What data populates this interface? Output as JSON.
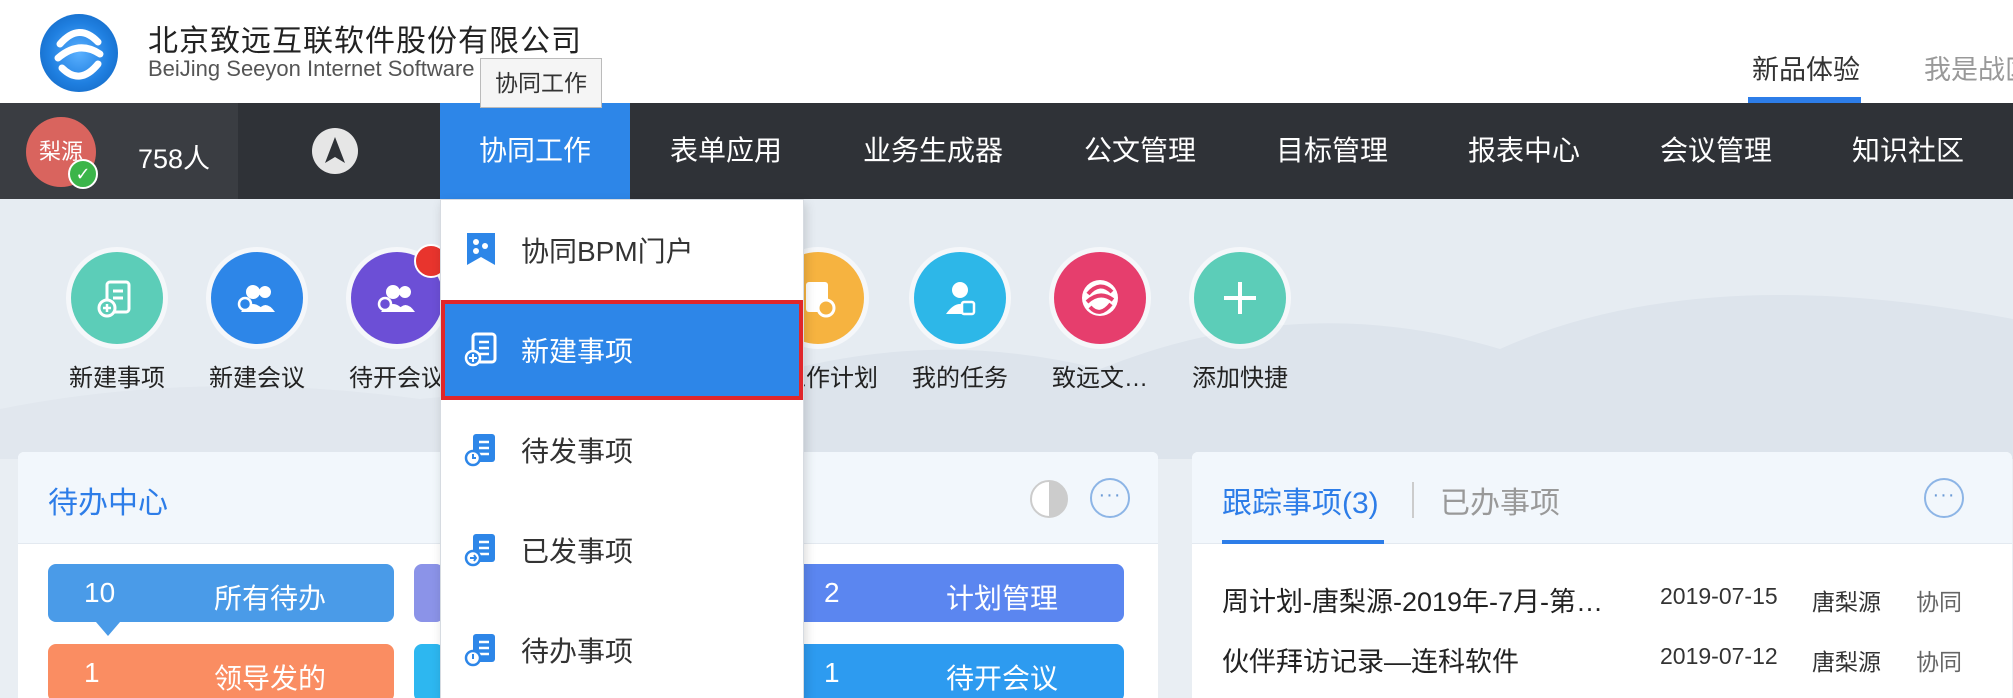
{
  "header": {
    "company_cn": "北京致远互联软件股份有限公司",
    "company_en": "BeiJing Seeyon Internet Software",
    "tabs": [
      {
        "label": "新品体验",
        "active": true
      },
      {
        "label": "我是战区",
        "active": false
      }
    ]
  },
  "user": {
    "avatar_text": "梨源",
    "people_count": "758人"
  },
  "nav": {
    "items": [
      {
        "label": "协同工作",
        "active": true
      },
      {
        "label": "表单应用"
      },
      {
        "label": "业务生成器"
      },
      {
        "label": "公文管理"
      },
      {
        "label": "目标管理"
      },
      {
        "label": "报表中心"
      },
      {
        "label": "会议管理"
      },
      {
        "label": "知识社区"
      }
    ],
    "tooltip": "协同工作"
  },
  "dropdown": {
    "items": [
      {
        "label": "协同BPM门户"
      },
      {
        "label": "新建事项",
        "selected": true
      },
      {
        "label": "待发事项"
      },
      {
        "label": "已发事项"
      },
      {
        "label": "待办事项"
      }
    ]
  },
  "shortcuts": [
    {
      "label": "新建事项",
      "color": "#5ccdb8",
      "icon": "new-item-icon"
    },
    {
      "label": "新建会议",
      "color": "#2d86e8",
      "icon": "new-meeting-icon"
    },
    {
      "label": "待开会议",
      "color": "#6c4fd6",
      "icon": "pending-meeting-icon"
    },
    {
      "label": "工作计划",
      "color": "#f6b340",
      "icon": "work-plan-icon"
    },
    {
      "label": "我的任务",
      "color": "#2db7e8",
      "icon": "my-task-icon"
    },
    {
      "label": "致远文…",
      "color": "#e63e6d",
      "icon": "seeyon-culture-icon"
    },
    {
      "label": "添加快捷",
      "color": "#5ccdb8",
      "icon": "add-shortcut-icon"
    }
  ],
  "todo_panel": {
    "title": "待办中心",
    "tiles": [
      {
        "count": "10",
        "label": "所有待办",
        "color": "#4a9be8"
      },
      {
        "count": "2",
        "label": "计划管理",
        "color": "#5b86f0"
      },
      {
        "count": "1",
        "label": "领导发的",
        "color": "#fa8d62"
      },
      {
        "count": "1",
        "label": "待开会议",
        "color": "#2d9bf0"
      }
    ]
  },
  "track_panel": {
    "tabs": [
      {
        "label": "跟踪事项(3)",
        "active": true
      },
      {
        "label": "已办事项",
        "active": false
      }
    ],
    "rows": [
      {
        "title": "周计划-唐梨源-2019年-7月-第…",
        "date": "2019-07-15",
        "person": "唐梨源",
        "type": "协同"
      },
      {
        "title": "伙伴拜访记录—连科软件",
        "date": "2019-07-12",
        "person": "唐梨源",
        "type": "协同"
      }
    ]
  }
}
